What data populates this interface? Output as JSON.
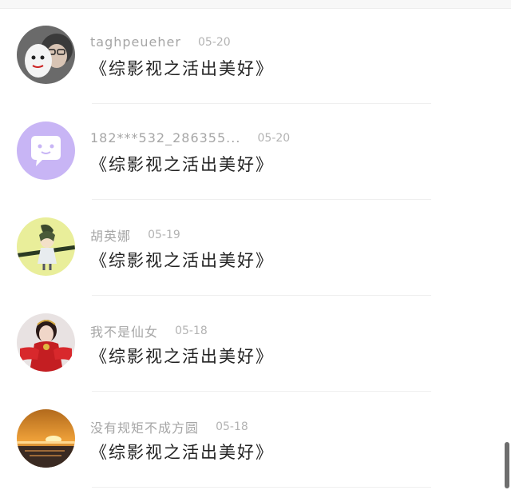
{
  "comments": [
    {
      "user": "taghpeueher",
      "date": "05-20",
      "text": "《综影视之活出美好》",
      "avatar": "robot-plush-with-glasses"
    },
    {
      "user": "182***532_286355...",
      "date": "05-20",
      "text": "《综影视之活出美好》",
      "avatar": "chat-bubble-icon"
    },
    {
      "user": "胡英娜",
      "date": "05-19",
      "text": "《综影视之活出美好》",
      "avatar": "anime-character"
    },
    {
      "user": "我不是仙女",
      "date": "05-18",
      "text": "《综影视之活出美好》",
      "avatar": "woman-red-costume"
    },
    {
      "user": "没有规矩不成方圆",
      "date": "05-18",
      "text": "《综影视之活出美好》",
      "avatar": "sunset-over-sea"
    }
  ],
  "colors": {
    "chat_avatar_bg": "#c8b5f5",
    "username": "#a6a6a6",
    "comment_text": "#222222"
  }
}
